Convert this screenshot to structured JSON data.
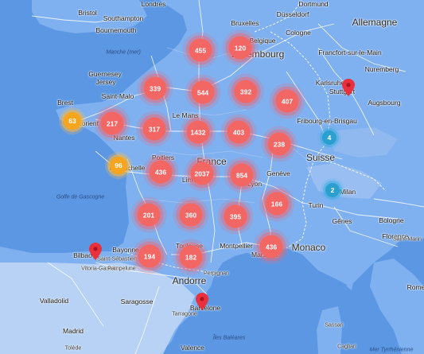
{
  "map": {
    "countries": [
      "Allemagne",
      "Luxembourg",
      "France",
      "Suisse",
      "Monaco",
      "Andorre"
    ],
    "cities": [
      "Bristol",
      "Londres",
      "Southampton",
      "Bournemouth",
      "Dortmund",
      "Düsseldorf",
      "Cologne",
      "Bruxelles",
      "Belgique",
      "Francfort-sur-le-Main",
      "Nuremberg",
      "Guernesey",
      "Jersey",
      "Saint-Malo",
      "Karlsruhe",
      "Stuttgart",
      "Augsbourg",
      "Fribourg-en-Brisgau",
      "Brest",
      "Lorient",
      "Le Mans",
      "Nantes",
      "Poitiers",
      "La Rochelle",
      "Limoges",
      "Genève",
      "Lyon",
      "Milan",
      "Turin",
      "Bologne",
      "Gênes",
      "Florence",
      "Bayonne",
      "Bilbao",
      "Saint-Sébastien",
      "Vitoria-Gasteiz",
      "Pampelune",
      "Toulouse",
      "Montpellier",
      "Marseille",
      "Perpignan",
      "Saragosse",
      "Barcelone",
      "Tarragone",
      "Valladolid",
      "Madrid",
      "Tolède",
      "Valence",
      "Sassari",
      "Cagliari",
      "Rome",
      "Saint-Marin"
    ],
    "sea_labels": [
      "Manche (mer)",
      "Golfe de Gascogne",
      "Mer Tyrrhénienne",
      "Îles Baléares"
    ]
  },
  "clusters": [
    {
      "count": "455",
      "color": "red"
    },
    {
      "count": "120",
      "color": "red"
    },
    {
      "count": "339",
      "color": "red"
    },
    {
      "count": "544",
      "color": "red"
    },
    {
      "count": "392",
      "color": "red"
    },
    {
      "count": "407",
      "color": "red"
    },
    {
      "count": "63",
      "color": "orange"
    },
    {
      "count": "217",
      "color": "red"
    },
    {
      "count": "317",
      "color": "red"
    },
    {
      "count": "1432",
      "color": "red"
    },
    {
      "count": "403",
      "color": "red"
    },
    {
      "count": "238",
      "color": "red"
    },
    {
      "count": "4",
      "color": "blue"
    },
    {
      "count": "96",
      "color": "orange"
    },
    {
      "count": "436",
      "color": "red"
    },
    {
      "count": "2037",
      "color": "red"
    },
    {
      "count": "854",
      "color": "red"
    },
    {
      "count": "2",
      "color": "blue"
    },
    {
      "count": "201",
      "color": "red"
    },
    {
      "count": "360",
      "color": "red"
    },
    {
      "count": "395",
      "color": "red"
    },
    {
      "count": "166",
      "color": "red"
    },
    {
      "count": "194",
      "color": "red"
    },
    {
      "count": "182",
      "color": "red"
    },
    {
      "count": "436",
      "color": "red"
    }
  ],
  "markers": [
    "Stuttgart",
    "Bilbao",
    "Barcelone"
  ],
  "colors": {
    "sea": "#5b97e3",
    "land": "#7fb0ef",
    "cluster_red": "#f26764",
    "cluster_orange": "#f5a51e",
    "cluster_blue": "#2a9fd0",
    "pin": "#e8313c"
  }
}
